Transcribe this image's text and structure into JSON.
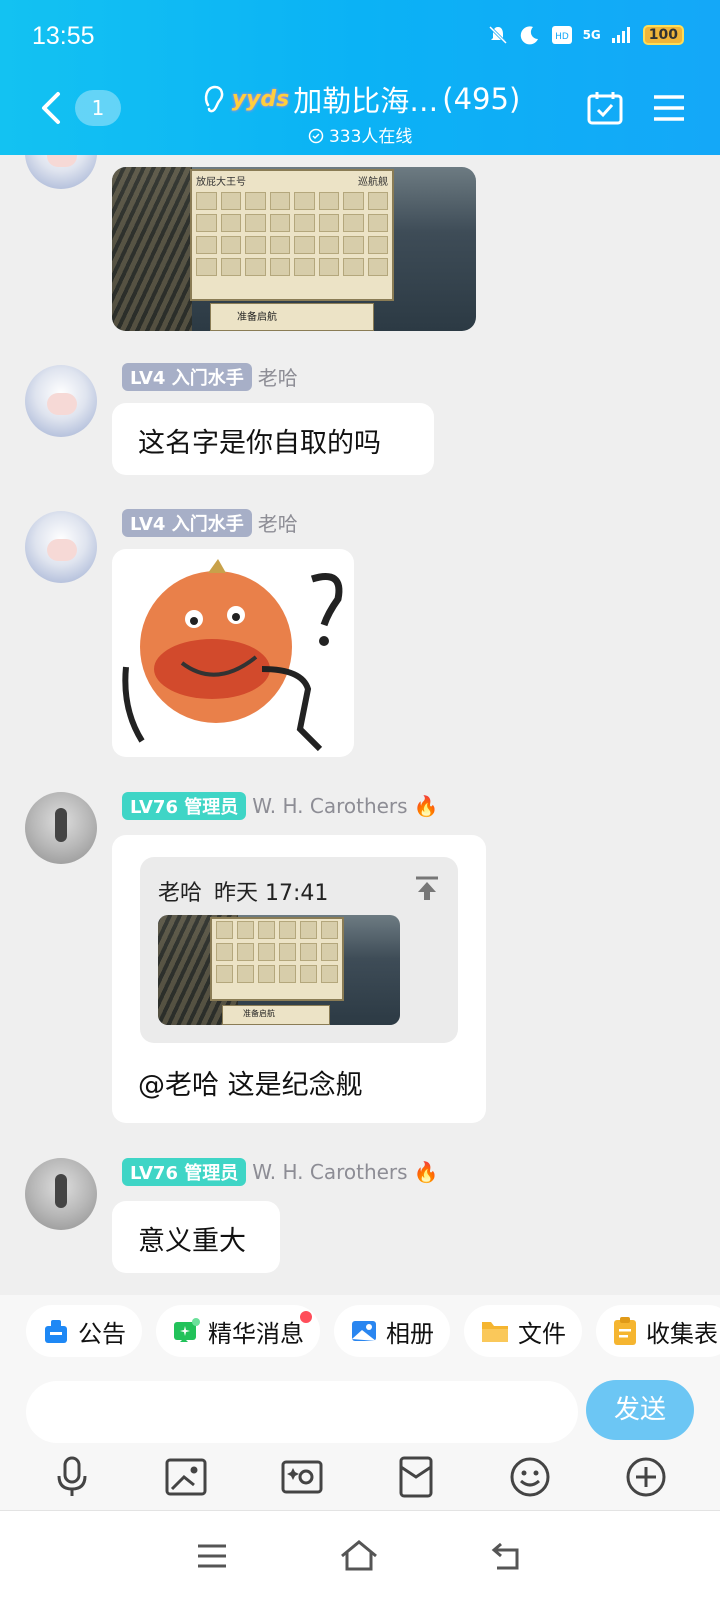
{
  "status": {
    "time": "13:55",
    "network": "5G",
    "battery": "100"
  },
  "header": {
    "unread": "1",
    "badge": "yyds",
    "group_name": "加勒比海…",
    "member_count": "(495)",
    "online": "333人在线"
  },
  "messages": [
    {
      "type": "image",
      "panel_title": "放屁大王号",
      "panel_class": "巡航舰",
      "launch": "准备启航"
    },
    {
      "type": "text",
      "level": "LV4",
      "title": "入门水手",
      "name": "老哈",
      "text": "这名字是你自取的吗"
    },
    {
      "type": "sticker",
      "level": "LV4",
      "title": "入门水手",
      "name": "老哈"
    },
    {
      "type": "reply",
      "level": "LV76",
      "title": "管理员",
      "name": "W. H. Carothers",
      "quote_name": "老哈",
      "quote_time": "昨天 17:41",
      "quote_launch": "准备启航",
      "text": "@老哈 这是纪念舰"
    },
    {
      "type": "text",
      "level": "LV76",
      "title": "管理员",
      "name": "W. H. Carothers",
      "text": "意义重大"
    }
  ],
  "chips": [
    {
      "label": "公告",
      "icon": "announcement-icon",
      "color": "#1e88f5"
    },
    {
      "label": "精华消息",
      "icon": "essence-icon",
      "color": "#22c25a"
    },
    {
      "label": "相册",
      "icon": "album-icon",
      "color": "#2a86f0"
    },
    {
      "label": "文件",
      "icon": "folder-icon",
      "color": "#f5b530"
    },
    {
      "label": "收集表",
      "icon": "form-icon",
      "color": "#f5b530"
    }
  ],
  "input": {
    "send": "发送"
  }
}
